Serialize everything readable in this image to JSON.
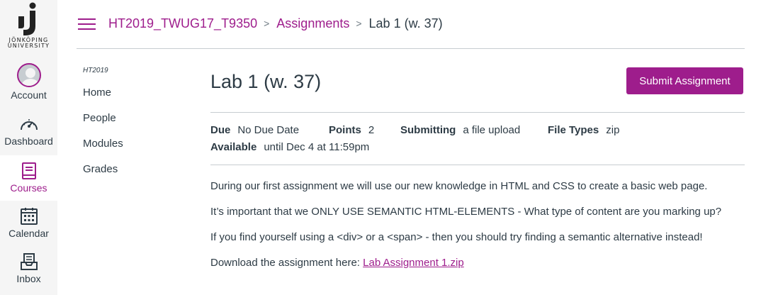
{
  "logo": {
    "line1": "JÖNKÖPING",
    "line2": "UNIVERSITY"
  },
  "global_nav": {
    "account": "Account",
    "dashboard": "Dashboard",
    "courses": "Courses",
    "calendar": "Calendar",
    "inbox": "Inbox"
  },
  "breadcrumb": {
    "course": "HT2019_TWUG17_T9350",
    "section": "Assignments",
    "current": "Lab 1 (w. 37)"
  },
  "course_nav": {
    "term": "HT2019",
    "items": [
      "Home",
      "People",
      "Modules",
      "Grades"
    ]
  },
  "assignment": {
    "title": "Lab 1 (w. 37)",
    "submit_label": "Submit Assignment",
    "due_label": "Due",
    "due_value": "No Due Date",
    "points_label": "Points",
    "points_value": "2",
    "submitting_label": "Submitting",
    "submitting_value": "a file upload",
    "filetypes_label": "File Types",
    "filetypes_value": "zip",
    "available_label": "Available",
    "available_value": "until Dec 4 at 11:59pm",
    "paragraphs": [
      "During our first assignment we will use our new knowledge in HTML and CSS to create a basic web page.",
      "It’s important that we ONLY USE SEMANTIC HTML-ELEMENTS - What type of content are you marking up?",
      "If you find yourself using a <div> or a <span> - then you should try finding a semantic alternative instead!"
    ],
    "download_text": "Download the assignment here: ",
    "download_link": "Lab Assignment 1.zip"
  },
  "colors": {
    "brand": "#9e1d8c",
    "text": "#2d3b45",
    "nav_bg": "#f5f5f5"
  }
}
